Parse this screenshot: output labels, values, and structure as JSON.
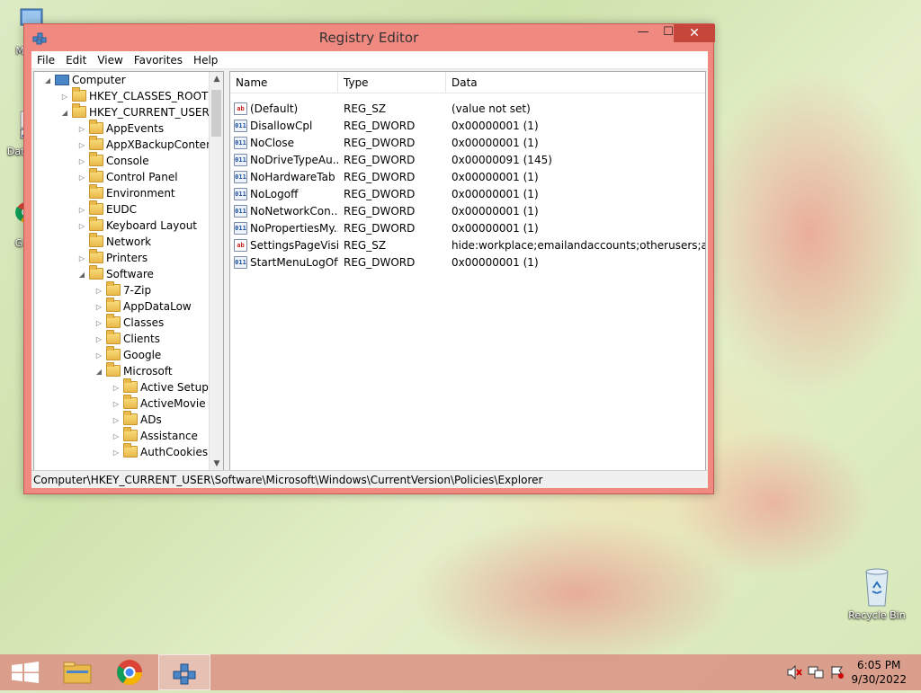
{
  "desktop": {
    "icons": [
      {
        "label": "My C"
      },
      {
        "label": "Data"
      },
      {
        "label": "G"
      },
      {
        "label": "Recycle Bin"
      }
    ]
  },
  "window": {
    "title": "Registry Editor",
    "min_glyph": "—",
    "max_glyph": "☐",
    "close_glyph": "✕"
  },
  "menu": [
    "File",
    "Edit",
    "View",
    "Favorites",
    "Help"
  ],
  "tree": [
    {
      "label": "Computer",
      "level": 0,
      "exp": "◢",
      "kind": "computer"
    },
    {
      "label": "HKEY_CLASSES_ROOT",
      "level": 1,
      "exp": "▷"
    },
    {
      "label": "HKEY_CURRENT_USER",
      "level": 1,
      "exp": "◢"
    },
    {
      "label": "AppEvents",
      "level": 2,
      "exp": "▷"
    },
    {
      "label": "AppXBackupContent",
      "level": 2,
      "exp": "▷"
    },
    {
      "label": "Console",
      "level": 2,
      "exp": "▷"
    },
    {
      "label": "Control Panel",
      "level": 2,
      "exp": "▷"
    },
    {
      "label": "Environment",
      "level": 2,
      "exp": ""
    },
    {
      "label": "EUDC",
      "level": 2,
      "exp": "▷"
    },
    {
      "label": "Keyboard Layout",
      "level": 2,
      "exp": "▷"
    },
    {
      "label": "Network",
      "level": 2,
      "exp": ""
    },
    {
      "label": "Printers",
      "level": 2,
      "exp": "▷"
    },
    {
      "label": "Software",
      "level": 2,
      "exp": "◢"
    },
    {
      "label": "7-Zip",
      "level": 3,
      "exp": "▷"
    },
    {
      "label": "AppDataLow",
      "level": 3,
      "exp": "▷"
    },
    {
      "label": "Classes",
      "level": 3,
      "exp": "▷"
    },
    {
      "label": "Clients",
      "level": 3,
      "exp": "▷"
    },
    {
      "label": "Google",
      "level": 3,
      "exp": "▷"
    },
    {
      "label": "Microsoft",
      "level": 3,
      "exp": "◢"
    },
    {
      "label": "Active Setup",
      "level": 4,
      "exp": "▷"
    },
    {
      "label": "ActiveMovie",
      "level": 4,
      "exp": "▷"
    },
    {
      "label": "ADs",
      "level": 4,
      "exp": "▷"
    },
    {
      "label": "Assistance",
      "level": 4,
      "exp": "▷"
    },
    {
      "label": "AuthCookies",
      "level": 4,
      "exp": "▷"
    }
  ],
  "list": {
    "columns": [
      "Name",
      "Type",
      "Data"
    ],
    "rows": [
      {
        "name": "(Default)",
        "type": "REG_SZ",
        "data": "(value not set)",
        "icon": "sz"
      },
      {
        "name": "DisallowCpl",
        "type": "REG_DWORD",
        "data": "0x00000001 (1)",
        "icon": "dw"
      },
      {
        "name": "NoClose",
        "type": "REG_DWORD",
        "data": "0x00000001 (1)",
        "icon": "dw"
      },
      {
        "name": "NoDriveTypeAu...",
        "type": "REG_DWORD",
        "data": "0x00000091 (145)",
        "icon": "dw"
      },
      {
        "name": "NoHardwareTab",
        "type": "REG_DWORD",
        "data": "0x00000001 (1)",
        "icon": "dw"
      },
      {
        "name": "NoLogoff",
        "type": "REG_DWORD",
        "data": "0x00000001 (1)",
        "icon": "dw"
      },
      {
        "name": "NoNetworkCon...",
        "type": "REG_DWORD",
        "data": "0x00000001 (1)",
        "icon": "dw"
      },
      {
        "name": "NoPropertiesMy...",
        "type": "REG_DWORD",
        "data": "0x00000001 (1)",
        "icon": "dw"
      },
      {
        "name": "SettingsPageVisi...",
        "type": "REG_SZ",
        "data": "hide:workplace;emailandaccounts;otherusers;assig...",
        "icon": "sz"
      },
      {
        "name": "StartMenuLogOff",
        "type": "REG_DWORD",
        "data": "0x00000001 (1)",
        "icon": "dw"
      }
    ]
  },
  "status_path": "Computer\\HKEY_CURRENT_USER\\Software\\Microsoft\\Windows\\CurrentVersion\\Policies\\Explorer",
  "taskbar": {
    "time": "6:05 PM",
    "date": "9/30/2022"
  },
  "colors": {
    "window_frame": "#f08a80",
    "close_button": "#c7463c",
    "taskbar": "#da9888"
  },
  "icon_names": {
    "sz_glyph": "ab",
    "dw_glyph": "011"
  }
}
